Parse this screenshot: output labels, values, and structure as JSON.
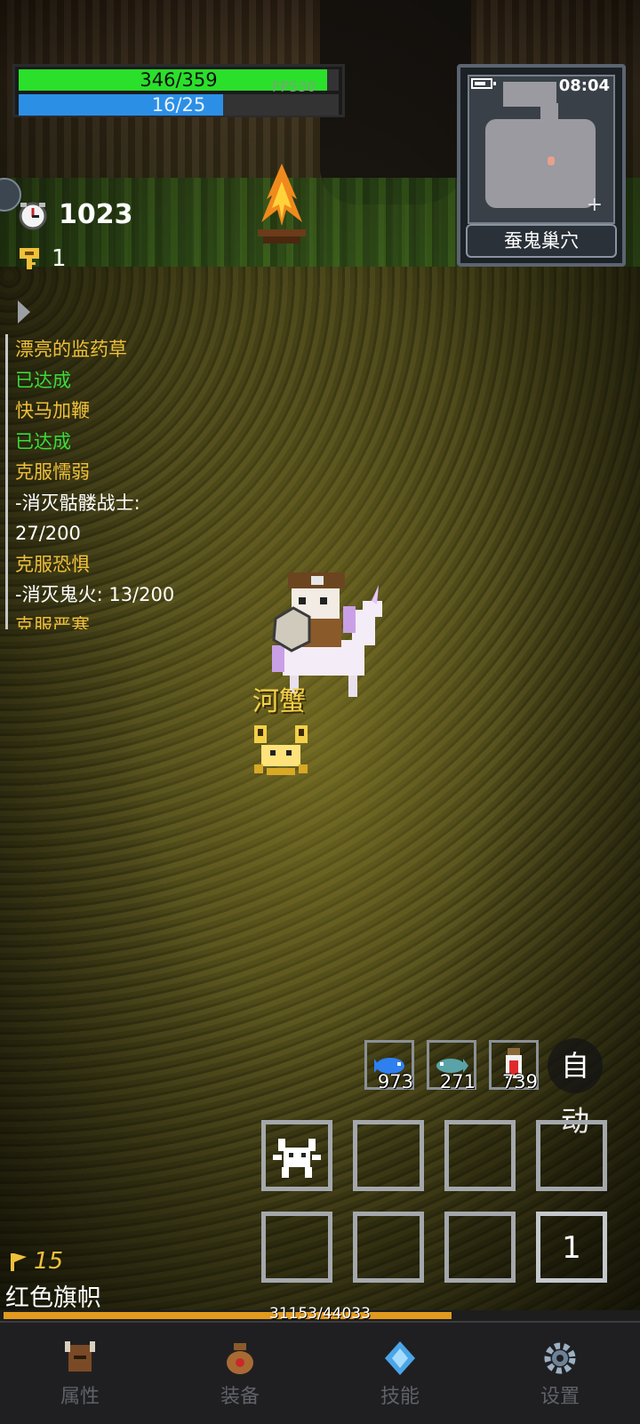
{
  "hud": {
    "hp": {
      "text": "346/359",
      "current": 346,
      "max": 359
    },
    "mp": {
      "text": "16/25",
      "current": 16,
      "max": 25
    },
    "fps": "FPS30"
  },
  "minimap": {
    "time": "08:04",
    "location": "蚕鬼巢穴"
  },
  "stats": {
    "time_value": "1023",
    "keys": "1"
  },
  "quests": [
    {
      "text": "漂亮的监药草",
      "kind": "title"
    },
    {
      "text": "已达成",
      "kind": "done"
    },
    {
      "text": "快马加鞭",
      "kind": "title"
    },
    {
      "text": "已达成",
      "kind": "done"
    },
    {
      "text": "克服懦弱",
      "kind": "title"
    },
    {
      "text": "-消灭骷髅战士:",
      "kind": "prog"
    },
    {
      "text": "27/200",
      "kind": "prog"
    },
    {
      "text": "克服恐惧",
      "kind": "title"
    },
    {
      "text": "-消灭鬼火: 13/200",
      "kind": "prog"
    },
    {
      "text": "克服严寒",
      "kind": "title"
    }
  ],
  "enemy": {
    "name": "河蟹"
  },
  "consumables": [
    {
      "name": "blue-fish",
      "count": "973"
    },
    {
      "name": "teal-fish",
      "count": "271"
    },
    {
      "name": "potion",
      "count": "739"
    }
  ],
  "auto_label": "自动",
  "skill_slot_number": "1",
  "flag": {
    "level": "15",
    "name": "红色旗帜"
  },
  "xp": {
    "text": "31153/44033",
    "current": 31153,
    "max": 44033
  },
  "nav": [
    {
      "label": "属性",
      "icon": "helmet-icon"
    },
    {
      "label": "装备",
      "icon": "bag-icon"
    },
    {
      "label": "技能",
      "icon": "crystal-icon"
    },
    {
      "label": "设置",
      "icon": "gear-icon"
    }
  ],
  "colors": {
    "hp": "#2ae02a",
    "mp": "#2c8fe6",
    "quest_title": "#f0c03a",
    "quest_done": "#3adc3a",
    "xp": "#e29a1d"
  }
}
